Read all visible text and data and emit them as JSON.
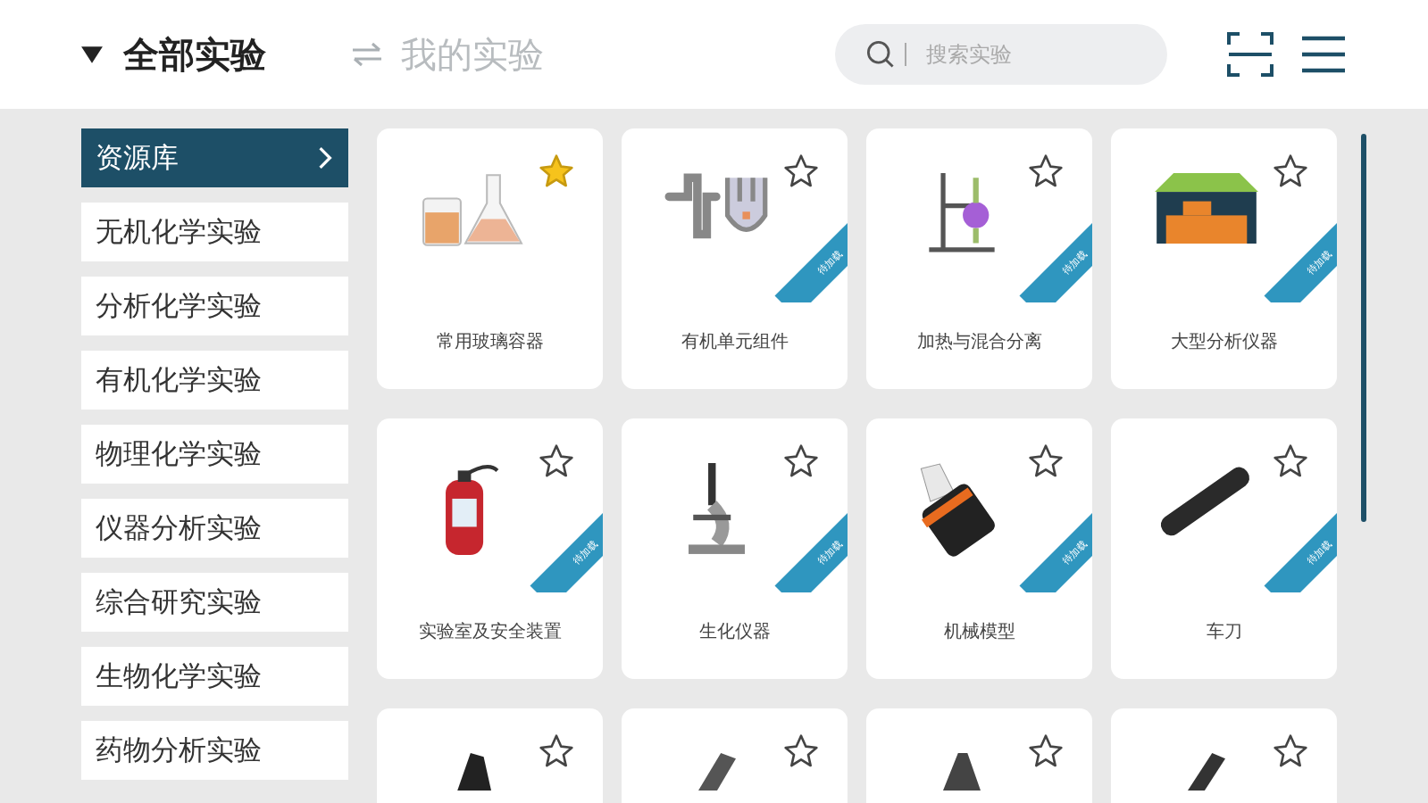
{
  "header": {
    "dropdown_label": "全部实验",
    "switch_label": "我的实验",
    "search": {
      "placeholder": "搜索实验"
    }
  },
  "sidebar": {
    "items": [
      {
        "label": "资源库",
        "selected": true
      },
      {
        "label": "无机化学实验",
        "selected": false
      },
      {
        "label": "分析化学实验",
        "selected": false
      },
      {
        "label": "有机化学实验",
        "selected": false
      },
      {
        "label": "物理化学实验",
        "selected": false
      },
      {
        "label": "仪器分析实验",
        "selected": false
      },
      {
        "label": "综合研究实验",
        "selected": false
      },
      {
        "label": "生物化学实验",
        "selected": false
      },
      {
        "label": "药物分析实验",
        "selected": false
      }
    ]
  },
  "cards": [
    {
      "label": "常用玻璃容器",
      "starred": true
    },
    {
      "label": "有机单元组件",
      "starred": false,
      "ribbon": "待加载"
    },
    {
      "label": "加热与混合分离",
      "starred": false,
      "ribbon": "待加载"
    },
    {
      "label": "大型分析仪器",
      "starred": false,
      "ribbon": "待加载"
    },
    {
      "label": "实验室及安全装置",
      "starred": false,
      "ribbon": "待加载"
    },
    {
      "label": "生化仪器",
      "starred": false,
      "ribbon": "待加载"
    },
    {
      "label": "机械模型",
      "starred": false,
      "ribbon": "待加载"
    },
    {
      "label": "车刀",
      "starred": false,
      "ribbon": "待加载"
    },
    {
      "starred": false
    },
    {
      "starred": false
    },
    {
      "starred": false
    },
    {
      "starred": false
    }
  ]
}
